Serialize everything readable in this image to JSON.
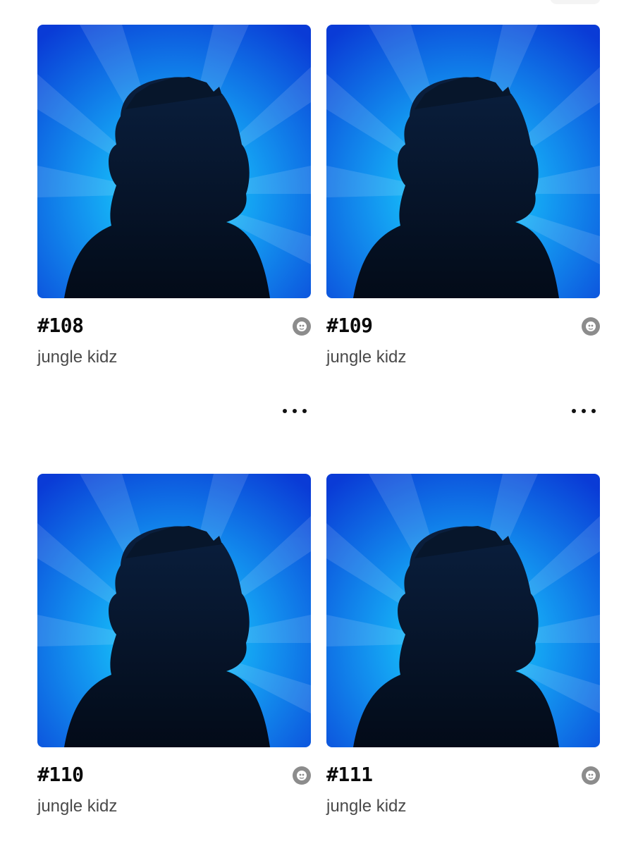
{
  "items": [
    {
      "token": "#108",
      "collection": "jungle kidz",
      "badge_icon": "ape-badge-icon",
      "menu_icon": "more-horizontal-icon"
    },
    {
      "token": "#109",
      "collection": "jungle kidz",
      "badge_icon": "ape-badge-icon",
      "menu_icon": "more-horizontal-icon"
    },
    {
      "token": "#110",
      "collection": "jungle kidz",
      "badge_icon": "ape-badge-icon"
    },
    {
      "token": "#111",
      "collection": "jungle kidz",
      "badge_icon": "ape-badge-icon"
    }
  ],
  "colors": {
    "sky_light": "#19e3ff",
    "sky_mid": "#1396f0",
    "sky_dark": "#0a3bd6",
    "silhouette": "#071a33"
  }
}
